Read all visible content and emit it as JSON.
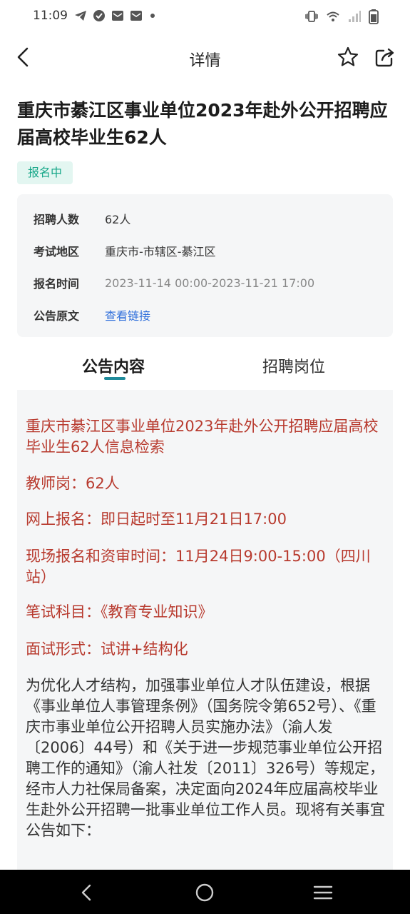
{
  "status_bar": {
    "time": "11:09",
    "left_icons": [
      "telegram-icon",
      "check-circle-icon",
      "mail-icon",
      "mail-icon",
      "dot-icon"
    ],
    "right_icons": [
      "vibrate-icon",
      "wifi-icon",
      "signal-icon",
      "battery-icon"
    ]
  },
  "nav": {
    "title": "详情",
    "icons": [
      "back-arrow-icon",
      "star-icon",
      "share-icon"
    ]
  },
  "article": {
    "title": "重庆市綦江区事业单位2023年赴外公开招聘应届高校毕业生62人",
    "status": "报名中"
  },
  "info": {
    "rows": [
      {
        "label": "招聘人数",
        "value": "62人"
      },
      {
        "label": "考试地区",
        "value": "重庆市-市辖区-綦江区"
      },
      {
        "label": "报名时间",
        "value": "2023-11-14 00:00-2023-11-21 17:00"
      },
      {
        "label": "公告原文",
        "value": "查看链接"
      }
    ]
  },
  "tabs": [
    {
      "label": "公告内容",
      "active": true
    },
    {
      "label": "招聘岗位",
      "active": false
    }
  ],
  "content": {
    "paragraphs": [
      "重庆市綦江区事业单位2023年赴外公开招聘应届高校毕业生62人信息检索",
      "教师岗：62人",
      "网上报名：即日起时至11月21日17:00",
      "现场报名和资审时间：11月24日9:00-15:00（四川站）",
      "笔试科目：《教育专业知识》",
      "面试形式：试讲+结构化",
      "为优化人才结构，加强事业单位人才队伍建设，根据《事业单位人事管理条例》（国务院令第652号）、《重庆市事业单位公开招聘人员实施办法》（渝人发〔2006〕44号）和《关于进一步规范事业单位公开招聘工作的通知》（渝人社发〔2011〕326号）等规定，经市人力社保局备案，决定面向2024年应届高校毕业生赴外公开招聘一批事业单位工作人员。现将有关事宜公告如下："
    ]
  },
  "system_nav": {
    "icons": [
      "back-icon",
      "home-icon",
      "recents-icon"
    ]
  },
  "colors": {
    "accent": "#1f8a9a",
    "badge_bg": "#e3f6f1",
    "badge_text": "#17a789",
    "highlight_red": "#b83a2e",
    "link_blue": "#2f6fdb",
    "card_bg": "#f5f6f7"
  }
}
